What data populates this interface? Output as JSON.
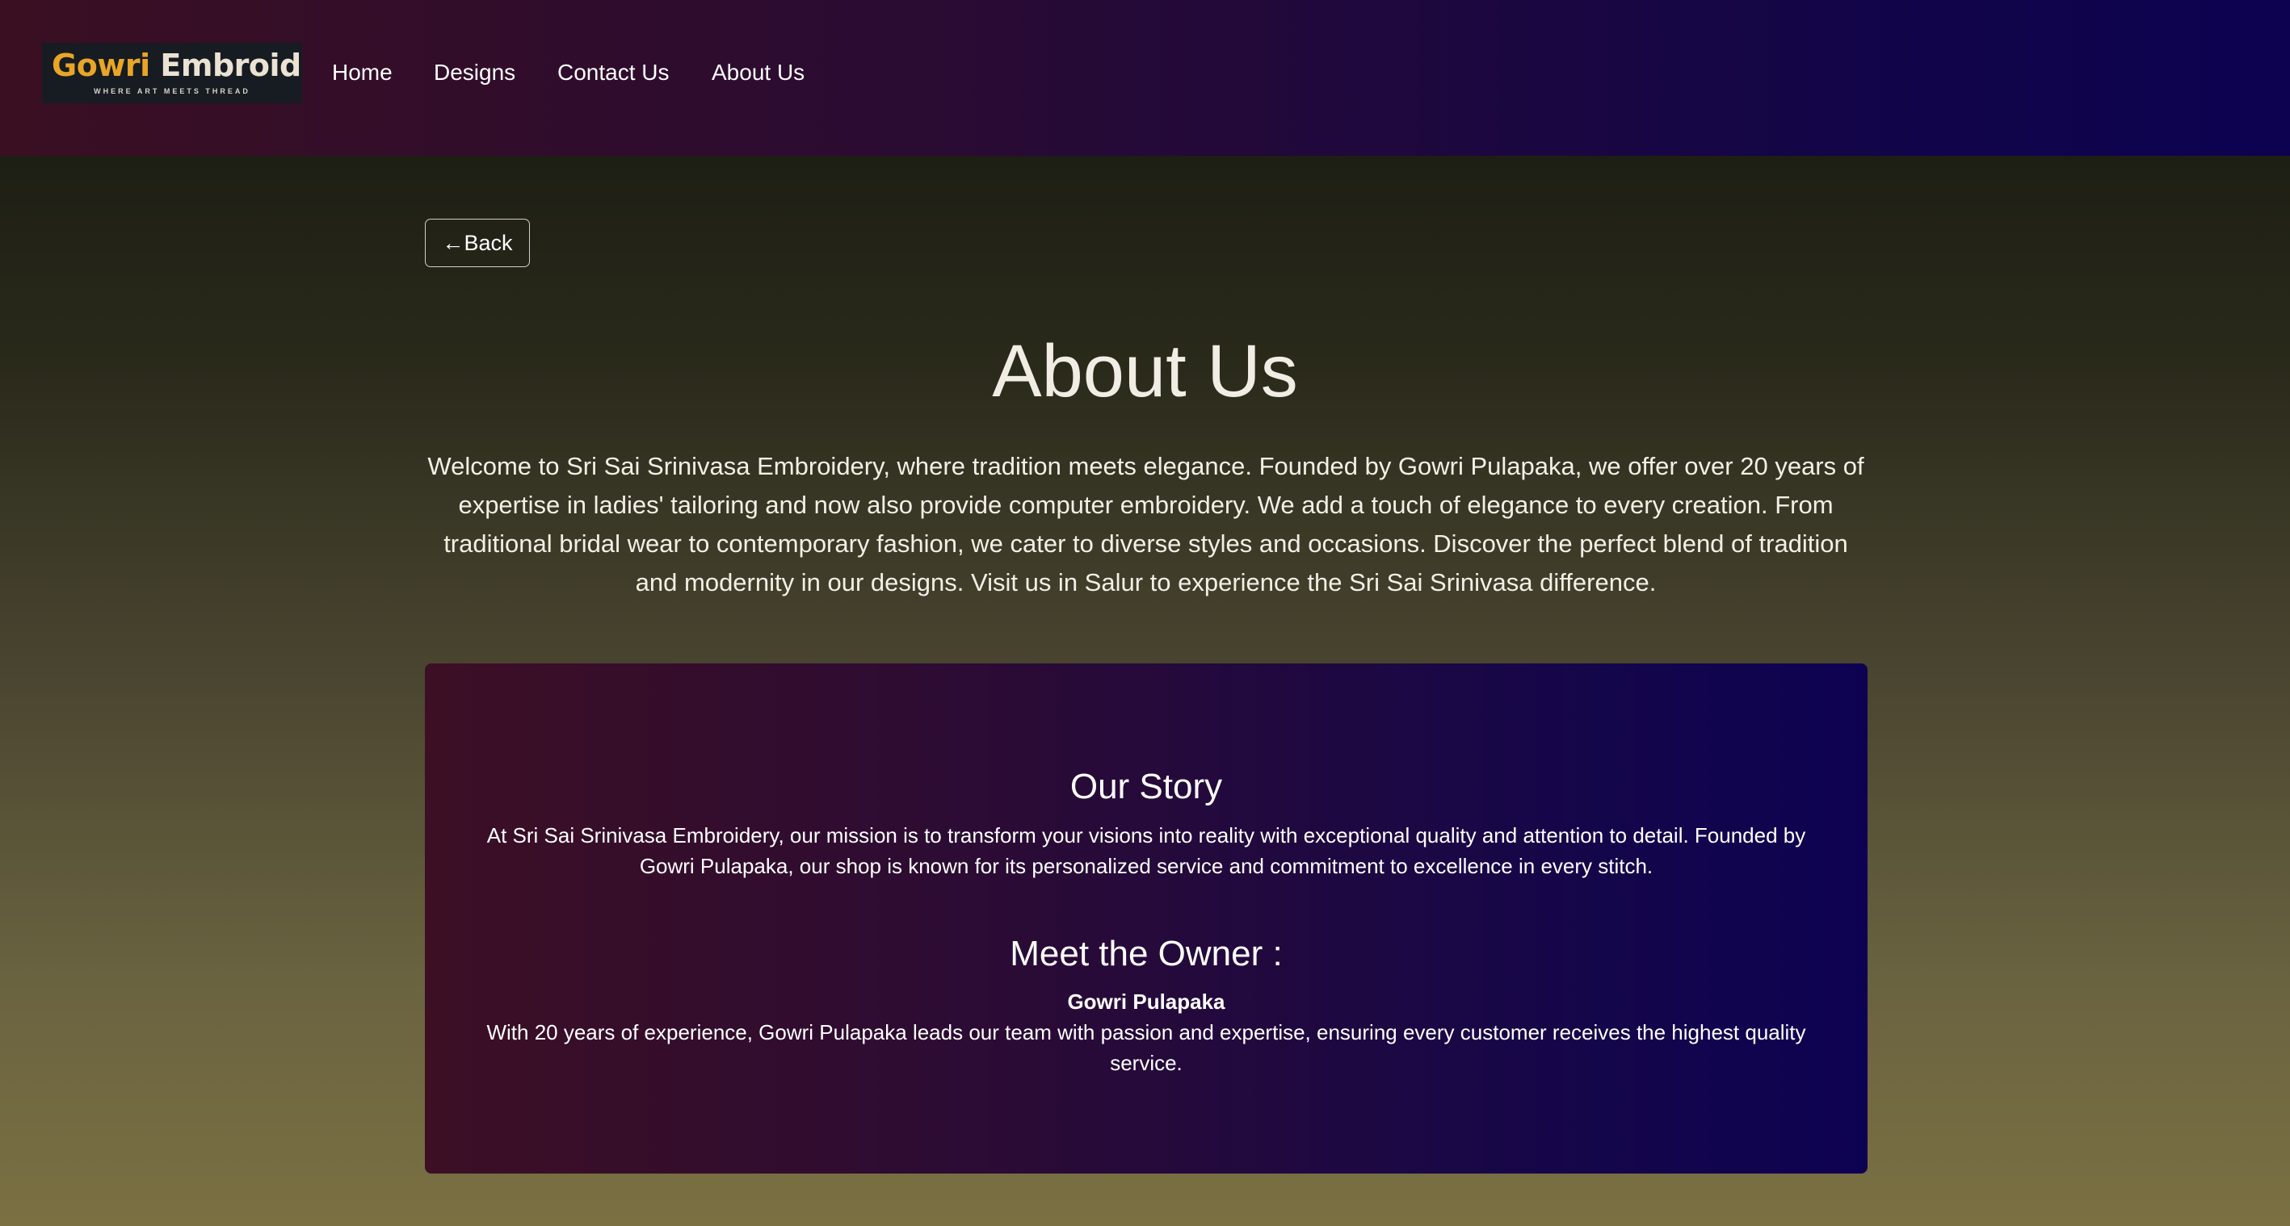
{
  "navbar": {
    "logo": {
      "title_part1": "Gowri",
      "title_part2": "Embroidery",
      "tagline": "WHERE ART MEETS THREAD"
    },
    "items": [
      {
        "label": "Home"
      },
      {
        "label": "Designs"
      },
      {
        "label": "Contact Us"
      },
      {
        "label": "About Us"
      }
    ]
  },
  "back_button": {
    "arrow": "←",
    "label": "Back"
  },
  "main": {
    "title": "About Us",
    "intro": "Welcome to Sri Sai Srinivasa Embroidery, where tradition meets elegance. Founded by Gowri Pulapaka, we offer over 20 years of expertise in ladies' tailoring and now also provide computer embroidery. We add a touch of elegance to every creation. From traditional bridal wear to contemporary fashion, we cater to diverse styles and occasions. Discover the perfect blend of tradition and modernity in our designs. Visit us in Salur to experience the Sri Sai Srinivasa difference."
  },
  "card": {
    "story_heading": "Our Story",
    "story_text": "At Sri Sai Srinivasa Embroidery, our mission is to transform your visions into reality with exceptional quality and attention to detail. Founded by Gowri Pulapaka, our shop is known for its personalized service and commitment to excellence in every stitch.",
    "owner_heading": "Meet the Owner :",
    "owner_name": "Gowri Pulapaka",
    "owner_text": "With 20 years of experience, Gowri Pulapaka leads our team with passion and expertise, ensuring every customer receives the highest quality service."
  },
  "colors": {
    "navbar_gradient_start": "#3a0f22",
    "navbar_gradient_end": "#0c0250",
    "logo_gold": "#e9a526",
    "page_gradient_top": "#15160f",
    "page_gradient_bottom": "#7a7042"
  }
}
